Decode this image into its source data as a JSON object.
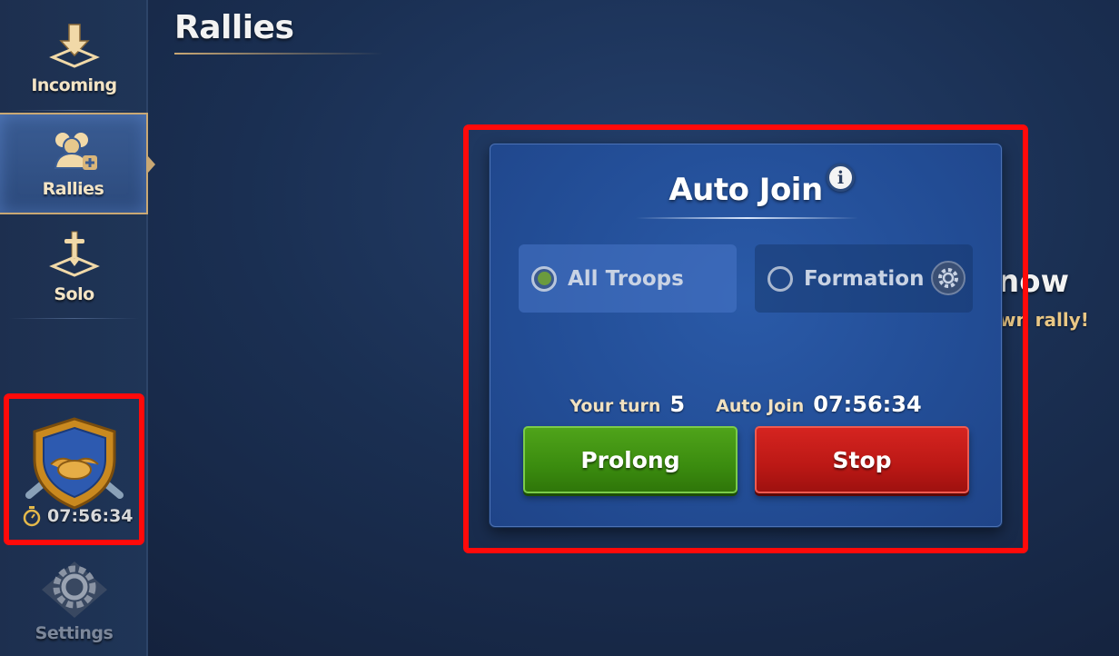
{
  "page": {
    "title": "Rallies"
  },
  "sidebar": {
    "items": [
      {
        "label": "Incoming",
        "icon": "arrow-down-icon"
      },
      {
        "label": "Rallies",
        "icon": "group-add-icon",
        "active": true
      },
      {
        "label": "Solo",
        "icon": "sword-icon"
      },
      {
        "label": "Settings",
        "icon": "gear-icon"
      }
    ],
    "badge": {
      "icon": "handshake-shield-icon",
      "timer": "07:56:34"
    }
  },
  "background": {
    "heading_fragment": "now",
    "subtext_fragment": "wn rally!"
  },
  "dialog": {
    "title": "Auto Join",
    "info_icon": "info-icon",
    "options": [
      {
        "label": "All Troops",
        "selected": true
      },
      {
        "label": "Formation",
        "selected": false
      }
    ],
    "turn_label": "Your turn",
    "turn_value": "5",
    "auto_join_label": "Auto Join",
    "auto_join_timer": "07:56:34",
    "prolong_label": "Prolong",
    "stop_label": "Stop"
  },
  "colors": {
    "highlight": "#ff0a0a",
    "prolong": "#3b8c0f",
    "stop": "#bb1815",
    "gold": "#c9a874"
  }
}
